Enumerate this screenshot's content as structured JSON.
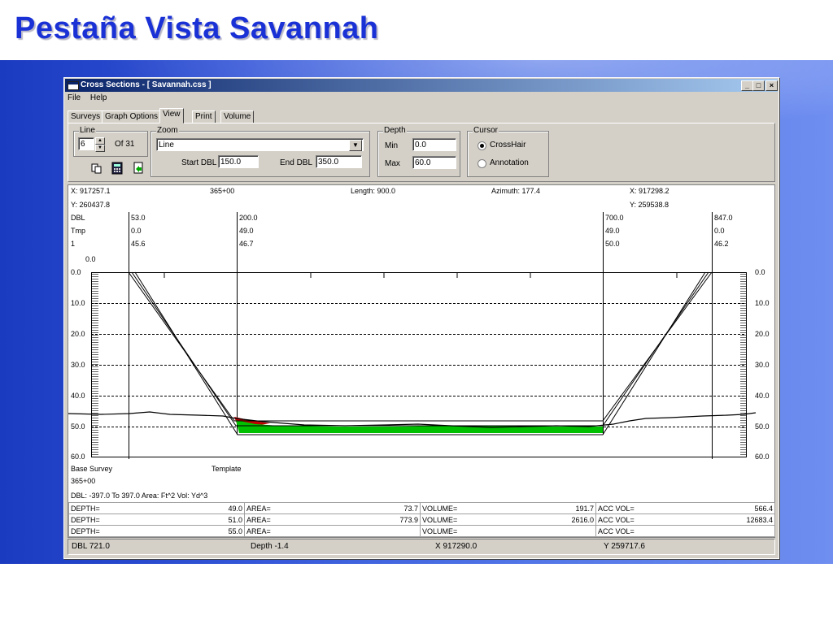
{
  "slide": {
    "title": "Pestaña Vista Savannah"
  },
  "window": {
    "title": "Cross  Sections - [ Savannah.css ]",
    "controls": [
      "_",
      "□",
      "×"
    ]
  },
  "menu": [
    "File",
    "Help"
  ],
  "tabs": [
    {
      "label": "Surveys",
      "active": false
    },
    {
      "label": "Graph Options",
      "active": false
    },
    {
      "label": "View",
      "active": true
    },
    {
      "label": "Print",
      "active": false
    },
    {
      "label": "Volume",
      "active": false
    }
  ],
  "line_group": {
    "label": "Line",
    "value": "6",
    "of_text": "Of 31"
  },
  "zoom_group": {
    "label": "Zoom",
    "mode": "Line",
    "start_label": "Start DBL",
    "start_value": "150.0",
    "end_label": "End DBL",
    "end_value": "350.0"
  },
  "depth_group": {
    "label": "Depth",
    "min_label": "Min",
    "min_value": "0.0",
    "max_label": "Max",
    "max_value": "60.0"
  },
  "cursor_group": {
    "label": "Cursor",
    "options": [
      "CrossHair",
      "Annotation"
    ],
    "selected": "CrossHair"
  },
  "tool_icons": [
    "copy-icon",
    "calculator-icon",
    "export-icon"
  ],
  "plot": {
    "header": {
      "x_left": "X: 917257.1",
      "y_left": "Y: 260437.8",
      "station": "365+00",
      "length": "Length: 900.0",
      "azimuth": "Azimuth: 177.4",
      "x_right": "X: 917298.2",
      "y_right": "Y: 259538.8"
    },
    "row_labels": [
      "DBL",
      "Tmp",
      "1"
    ],
    "columns": [
      {
        "dbl": "53.0",
        "tmp": "0.0",
        "s1": "45.6"
      },
      {
        "dbl": "200.0",
        "tmp": "49.0",
        "s1": "46.7"
      },
      {
        "dbl": "700.0",
        "tmp": "49.0",
        "s1": "50.0"
      },
      {
        "dbl": "847.0",
        "tmp": "0.0",
        "s1": "46.2"
      }
    ],
    "top_value": "0.0",
    "depth_ticks": [
      "0.0",
      "10.0",
      "20.0",
      "30.0",
      "40.0",
      "50.0",
      "60.0"
    ],
    "legend": {
      "base": "Base Survey",
      "template": "Template",
      "station": "365+00"
    },
    "colors": {
      "template": "#000000",
      "fill": "#00c000",
      "cut": "#c00000",
      "grid": "#000000"
    }
  },
  "volume_table": {
    "header": "DBL:  -397.0 To 397.0  Area: Ft^2 Vol: Yd^3",
    "rows": [
      {
        "depth_label": "DEPTH=",
        "depth": "49.0",
        "area_label": "AREA=",
        "area": "73.7",
        "volume_label": "VOLUME=",
        "volume": "191.7",
        "acc_label": "ACC VOL=",
        "acc": "566.4"
      },
      {
        "depth_label": "DEPTH=",
        "depth": "51.0",
        "area_label": "AREA=",
        "area": "773.9",
        "volume_label": "VOLUME=",
        "volume": "2616.0",
        "acc_label": "ACC VOL=",
        "acc": "12683.4"
      },
      {
        "depth_label": "DEPTH=",
        "depth": "55.0",
        "area_label": "AREA=",
        "area": "",
        "volume_label": "VOLUME=",
        "volume": "",
        "acc_label": "ACC VOL=",
        "acc": ""
      }
    ]
  },
  "status": {
    "dbl": "DBL 721.0",
    "depth": "Depth -1.4",
    "x": "X 917290.0",
    "y": "Y 259717.6"
  }
}
